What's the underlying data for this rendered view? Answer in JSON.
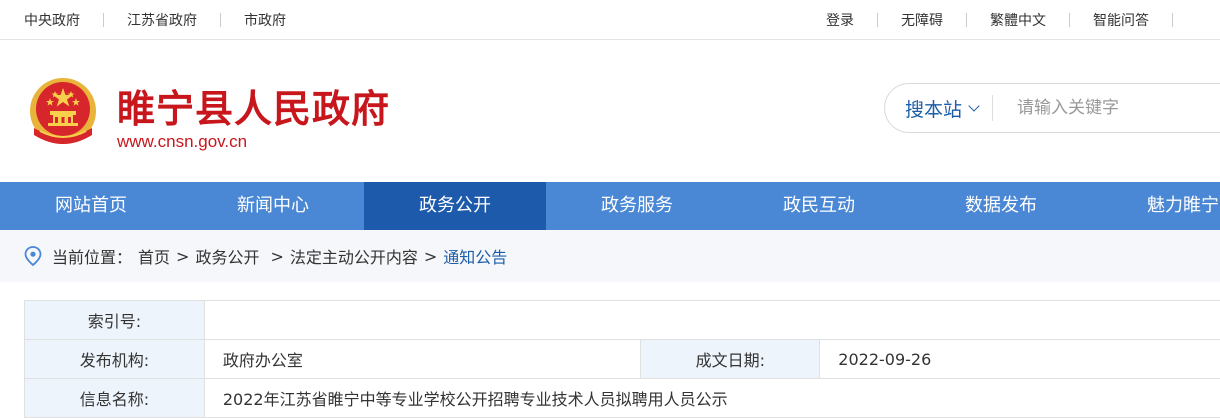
{
  "topbar": {
    "left_links": [
      "中央政府",
      "江苏省政府",
      "市政府"
    ],
    "right_links": [
      "登录",
      "无障碍",
      "繁體中文",
      "智能问答"
    ]
  },
  "header": {
    "title": "睢宁县人民政府",
    "url": "www.cnsn.gov.cn",
    "brand_color": "#c8161d"
  },
  "search": {
    "scope": "搜本站",
    "placeholder": "请输入关键字"
  },
  "nav": {
    "items": [
      "网站首页",
      "新闻中心",
      "政务公开",
      "政务服务",
      "政民互动",
      "数据发布",
      "魅力睢宁"
    ],
    "active": "政务公开",
    "color": "#4a87d4",
    "active_color": "#1d5aab"
  },
  "breadcrumb": {
    "label": "当前位置：",
    "items": [
      "首页",
      "政务公开",
      "法定主动公开内容",
      "通知公告"
    ],
    "separators": [
      ">",
      ">",
      ">"
    ]
  },
  "info": {
    "index_label": "索引号:",
    "index_value": "",
    "org_label": "发布机构:",
    "org_value": "政府办公室",
    "date_label": "成文日期:",
    "date_value": "2022-09-26",
    "name_label": "信息名称:",
    "name_value": "2022年江苏省睢宁中等专业学校公开招聘专业技术人员拟聘用人员公示"
  }
}
